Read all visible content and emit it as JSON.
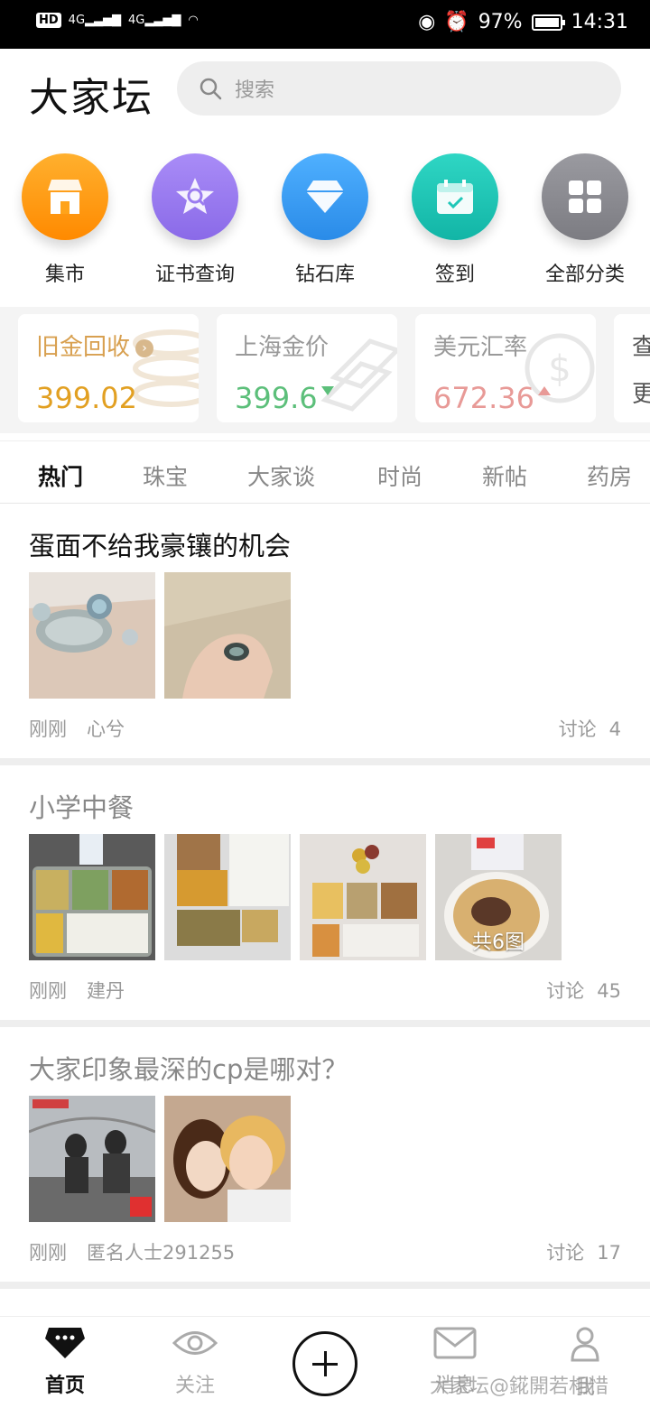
{
  "status_bar": {
    "hd": "HD",
    "sim1": "4G",
    "sim2": "4G",
    "battery": "97%",
    "time": "14:31"
  },
  "header": {
    "logo": "大家坛",
    "search_placeholder": "搜索"
  },
  "quick_links": [
    {
      "label": "集市",
      "icon": "store-icon",
      "color": "#ff9a1a"
    },
    {
      "label": "证书查询",
      "icon": "certificate-icon",
      "color": "#9b7cf0"
    },
    {
      "label": "钻石库",
      "icon": "diamond-icon",
      "color": "#3a9cf5"
    },
    {
      "label": "签到",
      "icon": "calendar-icon",
      "color": "#1fc7b8"
    },
    {
      "label": "全部分类",
      "icon": "grid-icon",
      "color": "#8b8b90"
    }
  ],
  "price_cards": [
    {
      "title": "旧金回收",
      "value": "399.02",
      "title_color": "#d8a050",
      "value_color": "#e2a022"
    },
    {
      "title": "上海金价",
      "value": "399.6",
      "title_color": "#999999",
      "value_color": "#5cbf7a",
      "trend": "down"
    },
    {
      "title": "美元汇率",
      "value": "672.36",
      "title_color": "#999999",
      "value_color": "#e89a97",
      "trend": "up"
    },
    {
      "title": "查",
      "value": "更"
    }
  ],
  "tabs": [
    "热门",
    "珠宝",
    "大家谈",
    "时尚",
    "新帖",
    "药房"
  ],
  "posts": [
    {
      "title": "蛋面不给我豪镶的机会",
      "time": "刚刚",
      "author": "心兮",
      "disc_label": "讨论",
      "disc_count": "4"
    },
    {
      "title": "小学中餐",
      "time": "刚刚",
      "author": "建丹",
      "disc_label": "讨论",
      "disc_count": "45",
      "more_badge": "共6图"
    },
    {
      "title": "大家印象最深的cp是哪对？",
      "time": "刚刚",
      "author": "匿名人士291255",
      "disc_label": "讨论",
      "disc_count": "17"
    }
  ],
  "bottom_nav": {
    "home": "首页",
    "follow": "关注",
    "messages": "消息",
    "me": "我"
  },
  "watermark": "大家坛@錵開若相惜"
}
